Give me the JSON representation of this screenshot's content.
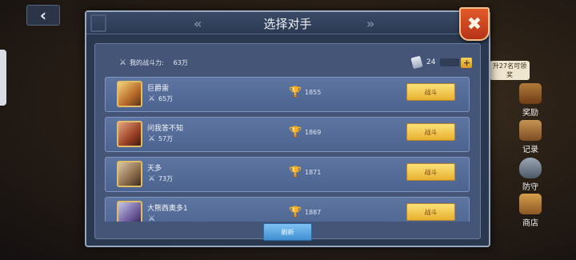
{
  "dialog": {
    "title": "选择对手",
    "close_label": "✖"
  },
  "my_power": {
    "label": "我的战斗力:",
    "value": "63万"
  },
  "tickets": {
    "count": "24",
    "add_label": "+"
  },
  "opponents": [
    {
      "name": "巨爵雷",
      "power": "65万",
      "score": "1855",
      "fight_label": "战斗"
    },
    {
      "name": "问我答不知",
      "power": "57万",
      "score": "1869",
      "fight_label": "战斗"
    },
    {
      "name": "天多",
      "power": "73万",
      "score": "1871",
      "fight_label": "战斗"
    },
    {
      "name": "大熊西奥多1",
      "power": "",
      "score": "1887",
      "fight_label": "战斗"
    }
  ],
  "refresh_label": "刷新",
  "background": {
    "reward_tip": "升27名可领奖",
    "side_menu": [
      "奖励",
      "记录",
      "防守",
      "商店"
    ]
  },
  "colors": {
    "dialog_bg": "#2a3850",
    "row_bg": "#5d75a0",
    "fight_button": "#f4c84a",
    "refresh_button": "#5aa7e4",
    "close_button": "#d94a24"
  }
}
